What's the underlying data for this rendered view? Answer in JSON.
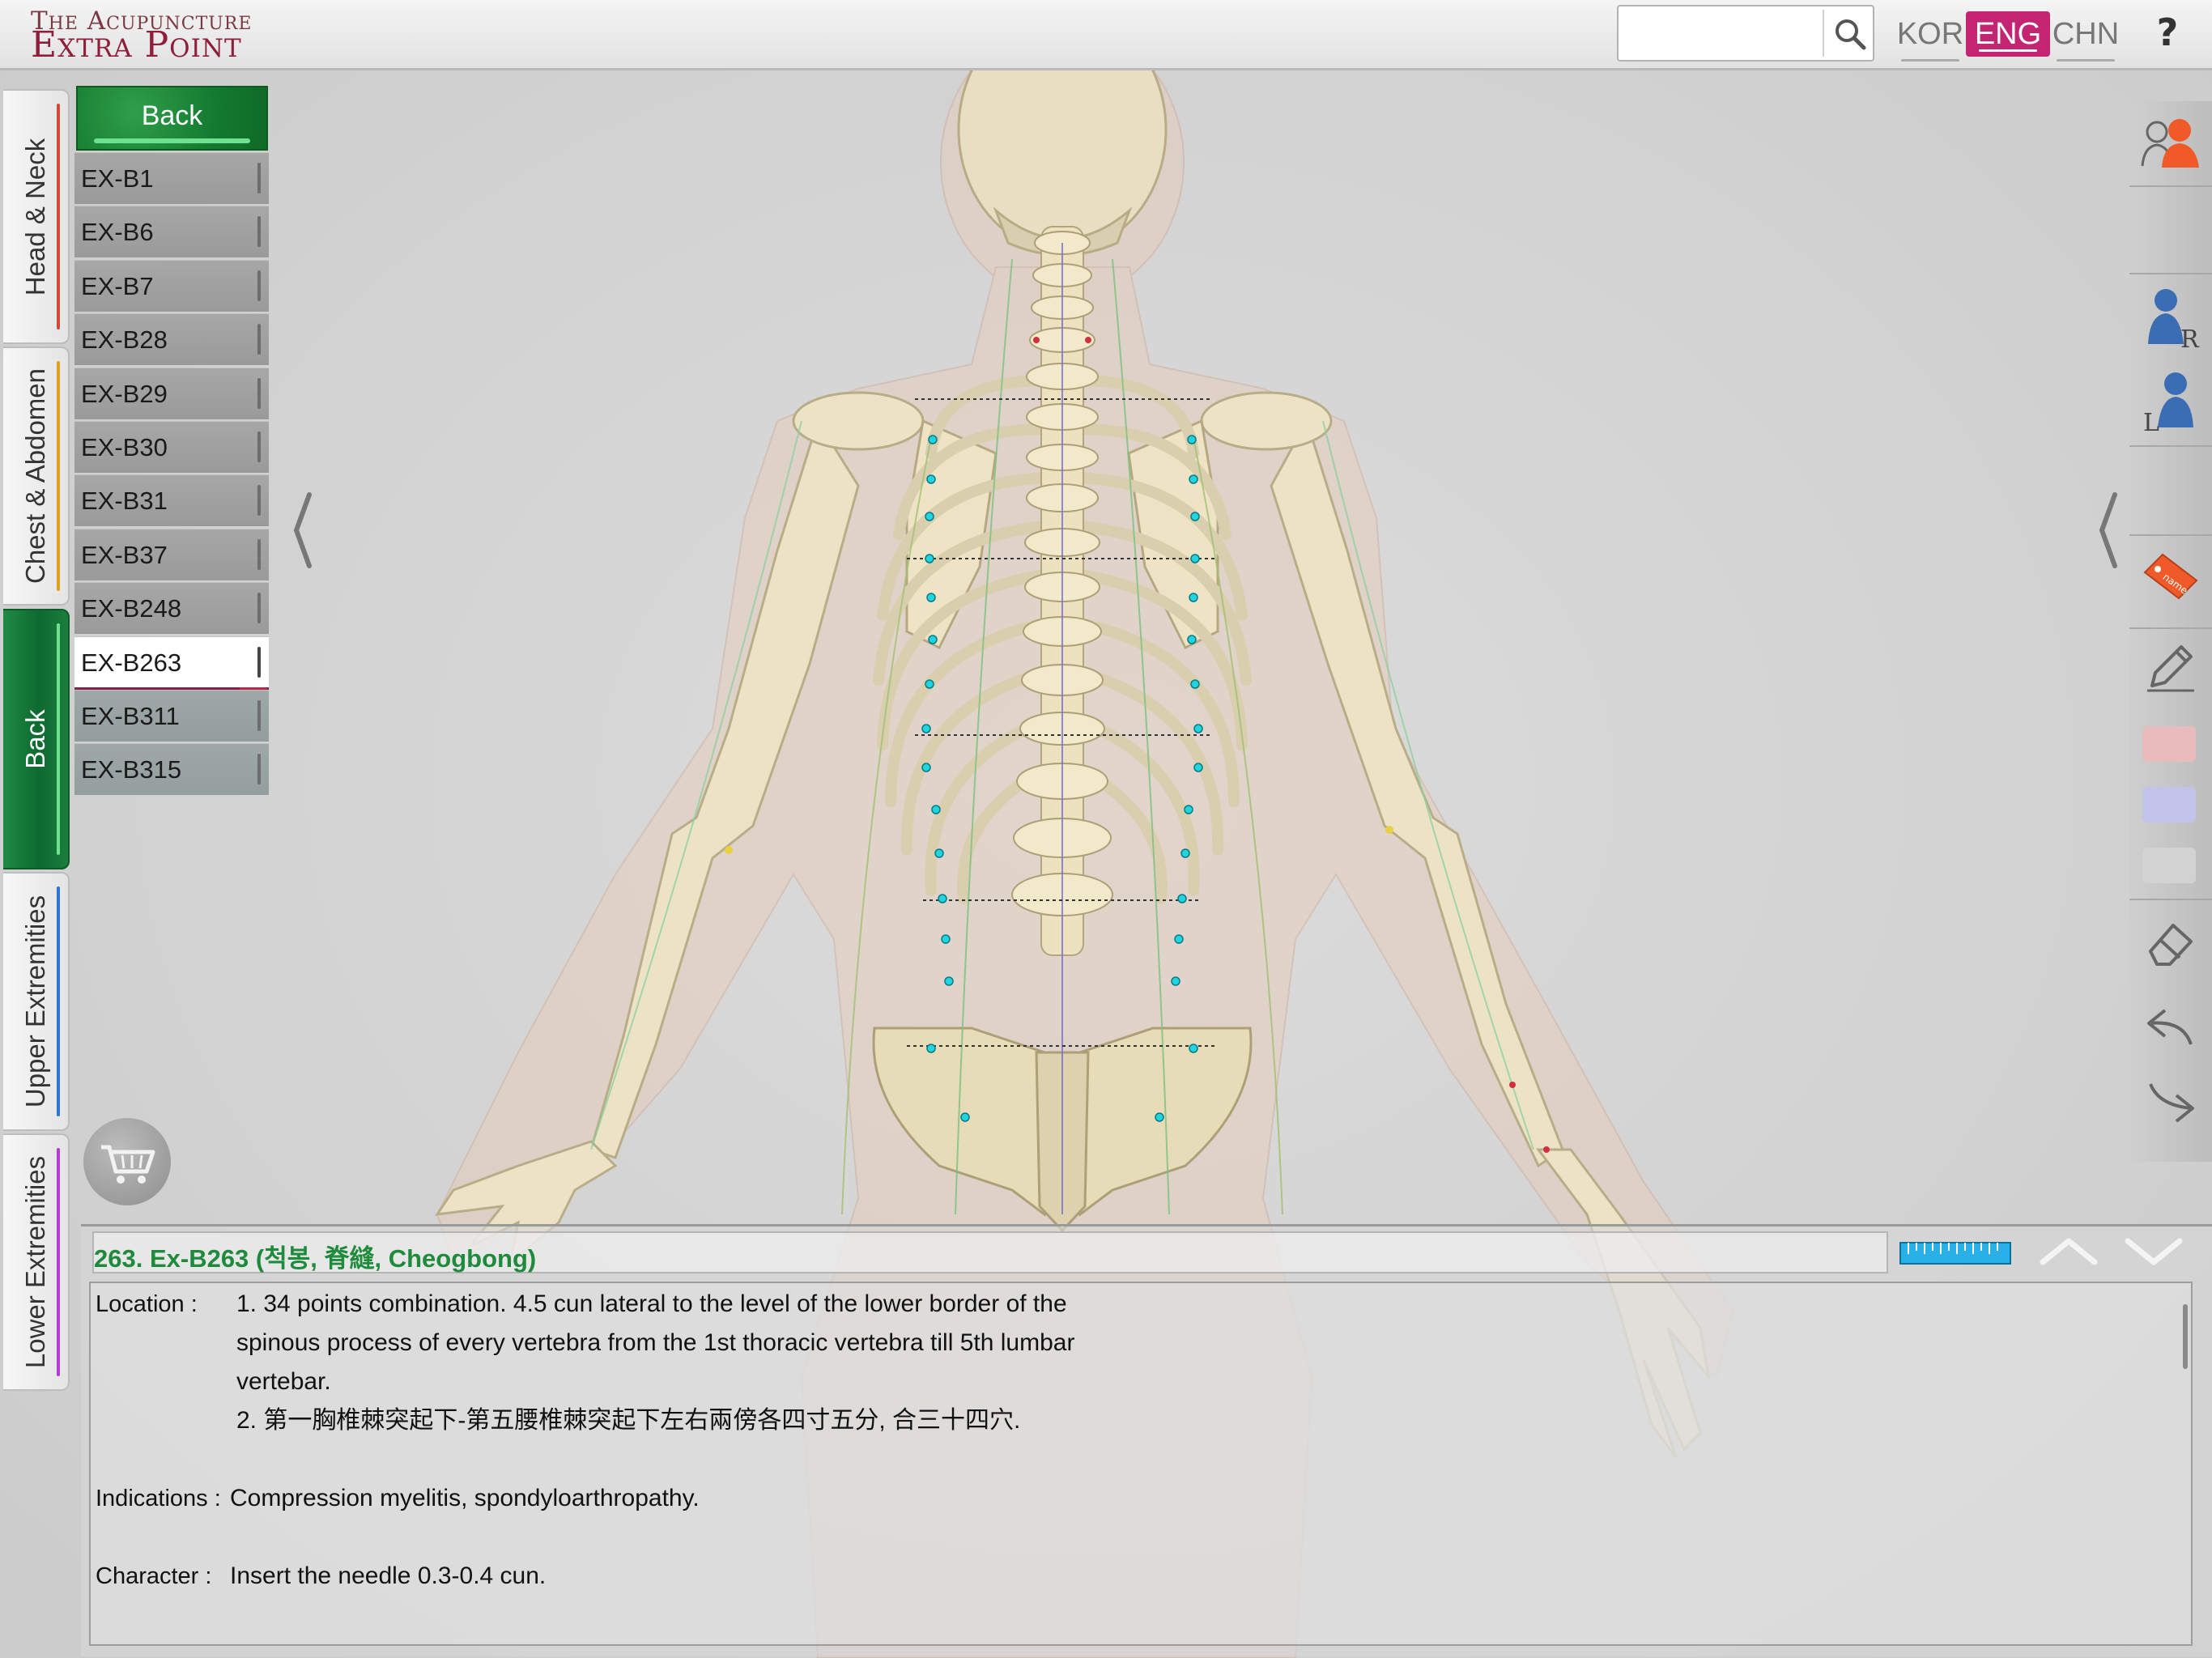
{
  "app": {
    "brand_small": "The Acupuncture",
    "brand_large": "Extra Point"
  },
  "search": {
    "placeholder": "",
    "value": ""
  },
  "languages": [
    {
      "code": "KOR",
      "active": false
    },
    {
      "code": "ENG",
      "active": true
    },
    {
      "code": "CHN",
      "active": false
    }
  ],
  "help_label": "?",
  "categories": [
    {
      "label": "Head & Neck",
      "active": false,
      "stripe": "#d04a3a"
    },
    {
      "label": "Chest & Abdomen",
      "active": false,
      "stripe": "#e0a020"
    },
    {
      "label": "Back",
      "active": true,
      "stripe": "#6fe08e"
    },
    {
      "label": "Upper Extremities",
      "active": false,
      "stripe": "#2f74d6"
    },
    {
      "label": "Lower Extremities",
      "active": false,
      "stripe": "#b43cd6"
    }
  ],
  "back_button": "Back",
  "points": [
    "EX-B1",
    "EX-B6",
    "EX-B7",
    "EX-B28",
    "EX-B29",
    "EX-B30",
    "EX-B31",
    "EX-B37",
    "EX-B248",
    "EX-B263",
    "EX-B311",
    "EX-B315"
  ],
  "selected_point": "EX-B263",
  "icons": {
    "cart": "shopping-cart-icon",
    "search": "search-icon",
    "toolbar": [
      "body-view-toggle-icon",
      "right-side-figure-icon",
      "left-side-figure-icon",
      "name-tag-icon",
      "pencil-icon",
      "eraser-icon",
      "undo-icon",
      "redo-icon"
    ]
  },
  "colors": {
    "accent_pink": "#c42573",
    "category_green": "#137a2f",
    "title_green": "#1e8a3c",
    "swatches": [
      "#e8bcbc",
      "#c2c2ea",
      "#d2d2d2"
    ]
  },
  "info": {
    "title": "263. Ex-B263 (척봉, 脊縫, Cheogbong)",
    "location_label": "Location :",
    "location_lines": [
      "1. 34 points combination. 4.5 cun lateral to the level of the lower border of the",
      "spinous process of every vertebra from the 1st thoracic vertebra till 5th lumbar",
      "vertebar.",
      "2. 第一胸椎棘突起下-第五腰椎棘突起下左右兩傍各四寸五分, 合三十四穴."
    ],
    "indications_label": "Indications :",
    "indications": "Compression myelitis, spondyloarthropathy.",
    "character_label": "Character :",
    "character": "Insert the needle 0.3-0.4 cun."
  }
}
